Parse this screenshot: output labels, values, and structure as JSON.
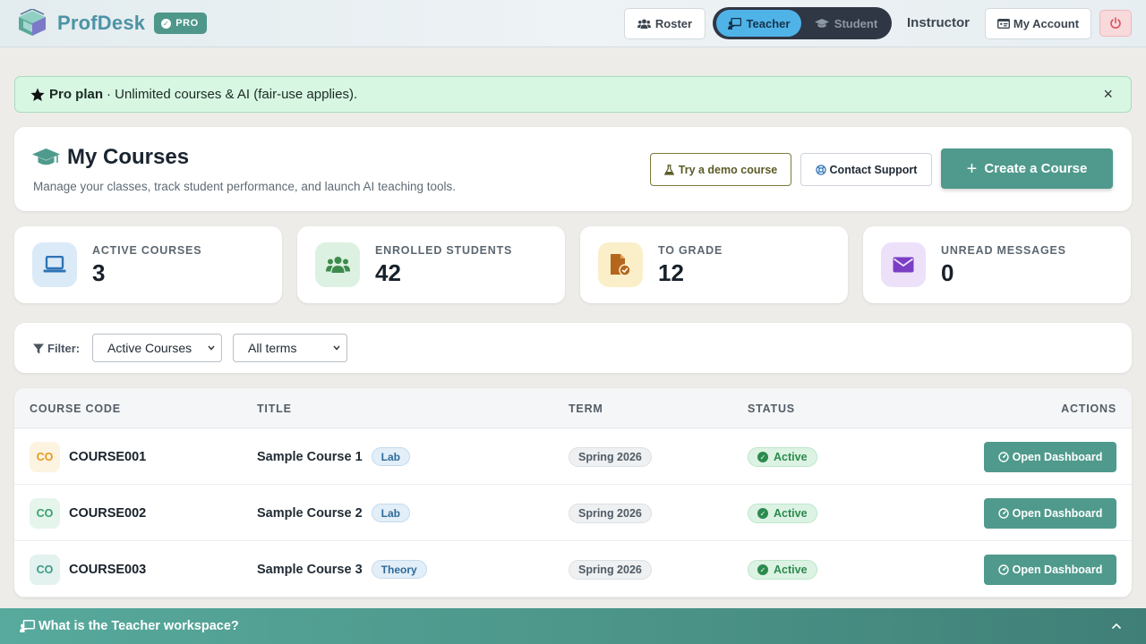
{
  "header": {
    "brand_name": "ProfDesk",
    "pro_badge": "PRO",
    "roster_label": "Roster",
    "mode_toggle": {
      "teacher_label": "Teacher",
      "student_label": "Student",
      "selected": "Teacher"
    },
    "role_label": "Instructor",
    "account_label": "My Account",
    "icons": {
      "brand": "graduation-cube-logo",
      "roster": "users-icon",
      "teacher": "chalkboard-teacher-icon",
      "student": "graduation-cap-icon",
      "account": "id-card-icon",
      "power": "power-icon"
    }
  },
  "pro_alert": {
    "strong": "Pro plan",
    "text": "· Unlimited courses & AI (fair-use applies).",
    "close": "×"
  },
  "courses_header": {
    "title": "My Courses",
    "subtitle": "Manage your classes, track student performance, and launch AI teaching tools.",
    "demo_label": "Try a demo course",
    "support_label": "Contact Support",
    "create_label": "Create a Course"
  },
  "stats": [
    {
      "label": "ACTIVE COURSES",
      "value": "3",
      "icon": "laptop-icon",
      "color": "#2f74b5",
      "bg": "#dbeaf7"
    },
    {
      "label": "ENROLLED STUDENTS",
      "value": "42",
      "icon": "users-icon",
      "color": "#3d8b4c",
      "bg": "#ddf1e2"
    },
    {
      "label": "TO GRADE",
      "value": "12",
      "icon": "file-check-icon",
      "color": "#b5661d",
      "bg": "#fbefc9"
    },
    {
      "label": "UNREAD MESSAGES",
      "value": "0",
      "icon": "envelope-icon",
      "color": "#7a3fc4",
      "bg": "#ede1fa"
    }
  ],
  "filter": {
    "label": "Filter:",
    "status_selected": "Active Courses",
    "term_selected": "All terms"
  },
  "table": {
    "headers": {
      "code": "COURSE CODE",
      "title": "TITLE",
      "term": "TERM",
      "status": "STATUS",
      "actions": "ACTIONS"
    },
    "rows": [
      {
        "badge": "CO",
        "badge_color": "#e69a1a",
        "badge_bg": "#fdf3e1",
        "code": "COURSE001",
        "title": "Sample Course 1",
        "tag": "Lab",
        "term": "Spring 2026",
        "status": "Active",
        "action": "Open Dashboard"
      },
      {
        "badge": "CO",
        "badge_color": "#3aa06a",
        "badge_bg": "#e5f5ec",
        "code": "COURSE002",
        "title": "Sample Course 2",
        "tag": "Lab",
        "term": "Spring 2026",
        "status": "Active",
        "action": "Open Dashboard"
      },
      {
        "badge": "CO",
        "badge_color": "#3b9a86",
        "badge_bg": "#e3f2ef",
        "code": "COURSE003",
        "title": "Sample Course 3",
        "tag": "Theory",
        "term": "Spring 2026",
        "status": "Active",
        "action": "Open Dashboard"
      }
    ]
  },
  "bottom_bar": {
    "label": "What is the Teacher workspace?"
  },
  "colors": {
    "accent": "#4f9a8c",
    "brand_text": "#4d93a6",
    "toggle_active": "#4fb3e8"
  }
}
